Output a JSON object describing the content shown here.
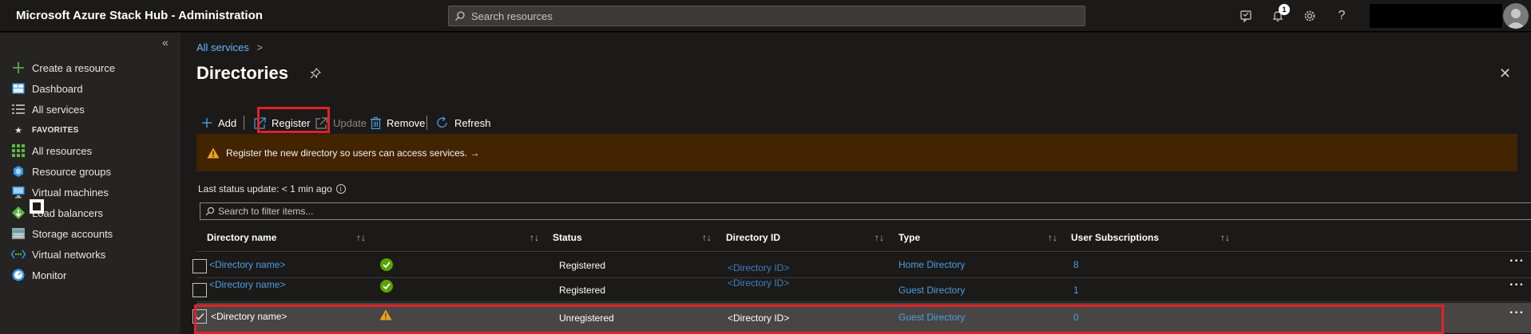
{
  "app": {
    "title": "Microsoft Azure Stack Hub - Administration",
    "search_placeholder": "Search resources",
    "notification_count": "1",
    "icons": [
      "feedback-icon",
      "bell-icon",
      "gear-icon",
      "help-icon"
    ],
    "help_label": "?"
  },
  "sidebar": {
    "collapse_label": "«",
    "items": [
      {
        "label": "Create a resource",
        "icon": "plus-icon"
      },
      {
        "label": "Dashboard",
        "icon": "dashboard-icon"
      },
      {
        "label": "All services",
        "icon": "list-icon"
      },
      {
        "label": "All resources",
        "icon": "grid-icon"
      },
      {
        "label": "Resource groups",
        "icon": "cube-icon"
      },
      {
        "label": "Virtual machines",
        "icon": "monitor-icon"
      },
      {
        "label": "Load balancers",
        "icon": "diamond-icon"
      },
      {
        "label": "Storage accounts",
        "icon": "storage-icon"
      },
      {
        "label": "Virtual networks",
        "icon": "network-icon"
      },
      {
        "label": "Monitor",
        "icon": "gauge-icon"
      }
    ],
    "favorites_label": "FAVORITES"
  },
  "breadcrumb": {
    "label": "All services",
    "separator": ">"
  },
  "page": {
    "title": "Directories",
    "close_label": "✕"
  },
  "toolbar": {
    "add": "Add",
    "register": "Register",
    "update": "Update",
    "remove": "Remove",
    "refresh": "Refresh"
  },
  "warning": {
    "text": "Register the new directory so users can access services. →",
    "color": "#432400"
  },
  "status": {
    "text": "Last status update: < 1 min ago",
    "info": "i"
  },
  "filter": {
    "placeholder": "Search to filter items..."
  },
  "table": {
    "columns": [
      "Directory name",
      "Status",
      "Directory ID",
      "Type",
      "User Subscriptions"
    ],
    "sort_glyph": "↑↓",
    "rows": [
      {
        "name": "<Directory name>",
        "status_icon": "check-circle-icon",
        "status": "Registered",
        "id": "<Directory ID>",
        "type": "Home Directory",
        "subs": "8",
        "selected": false
      },
      {
        "name": "<Directory name>",
        "status_icon": "check-circle-icon",
        "status": "Registered",
        "id": "<Directory ID>",
        "type": "Guest Directory",
        "subs": "1",
        "selected": false
      },
      {
        "name": "<Directory name>",
        "status_icon": "warning-icon",
        "status": "Unregistered",
        "id": "<Directory ID>",
        "type": "Guest Directory",
        "subs": "0",
        "selected": true
      }
    ],
    "more_label": "···"
  },
  "colors": {
    "accent": "#4f9ddf",
    "highlight": "#e0212b",
    "ok": "#57a300",
    "warn": "#f2a418"
  }
}
